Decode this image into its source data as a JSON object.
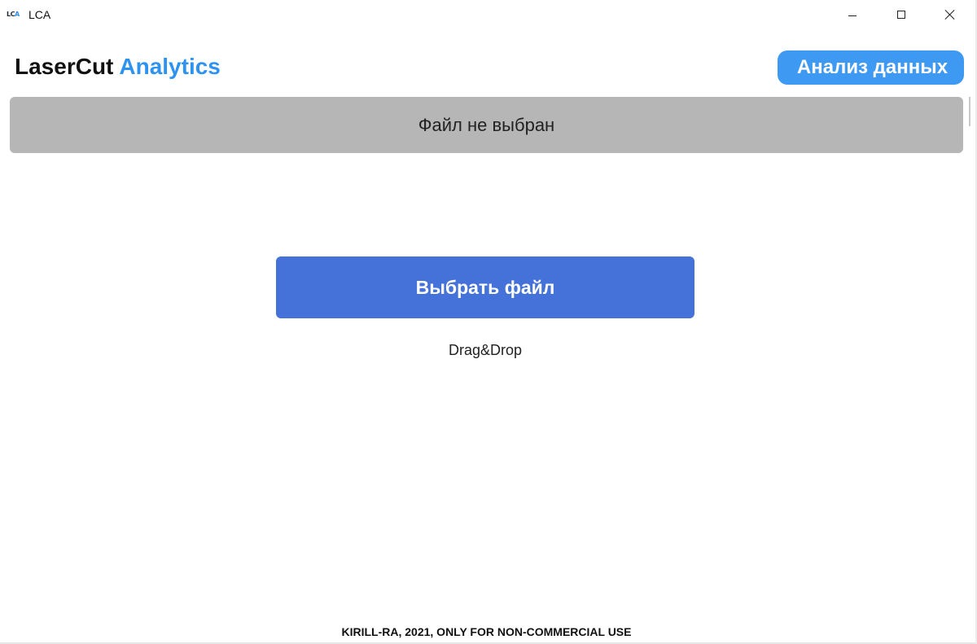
{
  "window": {
    "icon_left": "LC",
    "icon_right": "A",
    "title": "LCA",
    "controls": {
      "minimize": "minimize-icon",
      "maximize": "maximize-icon",
      "close": "close-icon"
    }
  },
  "header": {
    "brand_dark": "LaserCut",
    "brand_blue": "Analytics",
    "analyze_button": "Анализ данных"
  },
  "file_status": {
    "text": "Файл не выбран"
  },
  "upload": {
    "choose_button": "Выбрать файл",
    "hint": "Drag&Drop"
  },
  "footer": {
    "text": "KIRILL-RA, 2021, ONLY FOR NON-COMMERCIAL USE"
  },
  "colors": {
    "brand_blue": "#2e93f0",
    "analyze_button_bg": "#3d99f2",
    "choose_button_bg": "#4472d9",
    "status_bar_bg": "#b6b6b6"
  }
}
